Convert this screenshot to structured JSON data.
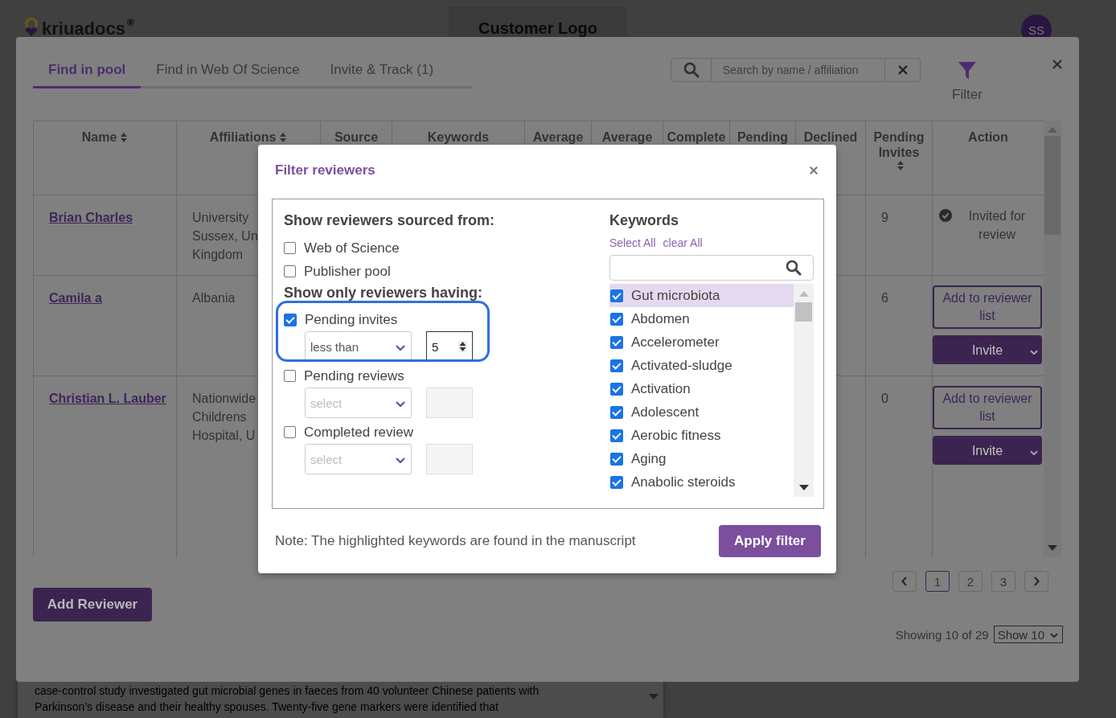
{
  "app_bar": {
    "logo": "kriuadocs",
    "logo_mark": "®",
    "customer_logo": "Customer Logo",
    "avatar": "SS"
  },
  "background_panel": {
    "lines": [
      "case-control study investigated gut microbial genes in faeces from 40 volunteer Chinese patients with",
      "Parkinson’s disease and their healthy spouses. Twenty-five gene markers were identified that"
    ]
  },
  "modal": {
    "tabs": [
      {
        "label": "Find in pool",
        "selected": true
      },
      {
        "label": "Find in Web Of Science",
        "selected": false
      },
      {
        "label": "Invite & Track (1)",
        "selected": false
      }
    ],
    "search": {
      "placeholder": "Search by name / affiliation"
    },
    "filter_label": "Filter",
    "table": {
      "columns": [
        {
          "label": "Name",
          "sortable": true
        },
        {
          "label": "Affiliations",
          "sortable": true
        },
        {
          "label": "Source",
          "sortable": false
        },
        {
          "label": "Keywords",
          "sortable": false
        },
        {
          "label": "Average",
          "sortable": false
        },
        {
          "label": "Average",
          "sortable": false
        },
        {
          "label": "Complete",
          "sortable": false
        },
        {
          "label": "Pending",
          "sortable": false
        },
        {
          "label": "Declined",
          "sortable": false
        },
        {
          "label": "Pending Invites",
          "sortable": true
        },
        {
          "label": "Action",
          "sortable": false
        }
      ],
      "rows": [
        {
          "name": "Brian Charles",
          "affiliation": [
            "University",
            "Sussex, Un",
            "Kingdom"
          ],
          "pending_invites": "9",
          "action": {
            "kind": "invited",
            "text": "Invited for review"
          }
        },
        {
          "name": "Camila a",
          "affiliation": [
            "Albania"
          ],
          "pending_invites": "6",
          "action": {
            "kind": "buttons",
            "add": "Add to reviewer list",
            "invite": "Invite"
          }
        },
        {
          "name": "Christian L. Lauber",
          "affiliation": [
            "Nationwide",
            "Childrens",
            "Hospital, U"
          ],
          "pending_invites": "0",
          "action": {
            "kind": "buttons",
            "add": "Add to reviewer list",
            "invite": "Invite"
          }
        }
      ]
    },
    "add_reviewer": "Add Reviewer",
    "pagination": [
      {
        "label": "1",
        "selected": true
      },
      {
        "label": "2",
        "selected": false
      },
      {
        "label": "3",
        "selected": false
      }
    ],
    "showing": "Showing 10 of 29",
    "page_size": "Show 10"
  },
  "filter_dialog": {
    "title": "Filter reviewers",
    "sources_heading": "Show reviewers sourced from:",
    "sources": [
      {
        "label": "Web of Science",
        "checked": false
      },
      {
        "label": "Publisher pool",
        "checked": false
      }
    ],
    "criteria_heading": "Show only reviewers having:",
    "criteria": [
      {
        "label": "Pending invites",
        "checked": true,
        "operator": {
          "value": "less than"
        },
        "count": "5"
      },
      {
        "label": "Pending reviews",
        "checked": false,
        "operator": {
          "placeholder": "select"
        }
      },
      {
        "label": "Completed review",
        "checked": false,
        "operator": {
          "placeholder": "select"
        }
      }
    ],
    "keywords_heading": "Keywords",
    "select_all": "Select All",
    "clear_all": "clear All",
    "keywords": [
      {
        "label": "Gut microbiota",
        "checked": true,
        "highlighted": true
      },
      {
        "label": "Abdomen",
        "checked": true,
        "highlighted": false
      },
      {
        "label": "Accelerometer",
        "checked": true,
        "highlighted": false
      },
      {
        "label": "Activated-sludge",
        "checked": true,
        "highlighted": false
      },
      {
        "label": "Activation",
        "checked": true,
        "highlighted": false
      },
      {
        "label": "Adolescent",
        "checked": true,
        "highlighted": false
      },
      {
        "label": "Aerobic fitness",
        "checked": true,
        "highlighted": false
      },
      {
        "label": "Aging",
        "checked": true,
        "highlighted": false
      },
      {
        "label": "Anabolic steroids",
        "checked": true,
        "highlighted": false
      }
    ],
    "note": "Note: The highlighted keywords are found in the manuscript",
    "apply": "Apply filter"
  }
}
